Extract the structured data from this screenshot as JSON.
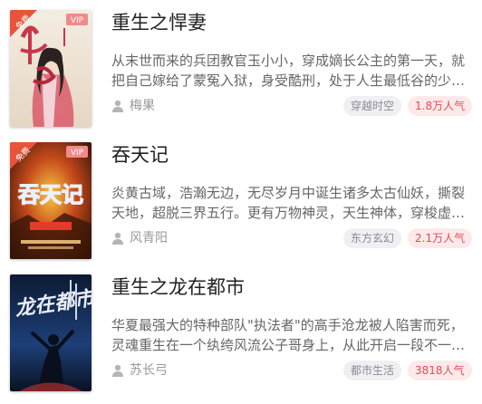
{
  "books": [
    {
      "title": "重生之悍妻",
      "description": "从末世而来的兵团教官玉小小，穿成嫡长公主的第一天，就把自己嫁给了蒙冤入狱，身受酷刑，处于人生最低谷的少年将军",
      "author": "梅果",
      "genre": "穿越时空",
      "popularity": "1.8万人气",
      "cover": {
        "free_badge": "免费",
        "vip_badge": "VIP",
        "art_text": "悍妻"
      }
    },
    {
      "title": "吞天记",
      "description": "炎黄古域，浩瀚无边，无尽岁月中诞生诸多太古仙妖，撕裂天地，超脱三界五行。更有万物神灵，天生神体，穿梭虚空，掌控大道",
      "author": "风青阳",
      "genre": "东方玄幻",
      "popularity": "2.1万人气",
      "cover": {
        "free_badge": "免费",
        "vip_badge": "VIP",
        "art_text": "吞天记"
      }
    },
    {
      "title": "重生之龙在都市",
      "description": "华夏最强大的特种部队\"执法者\"的高手沧龙被人陷害而死，灵魂重生在一个纨绔风流公子哥身上，从此开启一段不一样的人生",
      "author": "苏长弓",
      "genre": "都市生活",
      "popularity": "3818人气",
      "cover": {
        "art_text": "龙在都市"
      }
    }
  ],
  "colors": {
    "free_badge": "#e8533a",
    "vip_badge": "#f08a8a",
    "popularity_text": "#e64a55",
    "popularity_bg": "#fde9ea",
    "genre_bg": "#f0f0f3"
  },
  "icons": {
    "author": "person-icon"
  }
}
